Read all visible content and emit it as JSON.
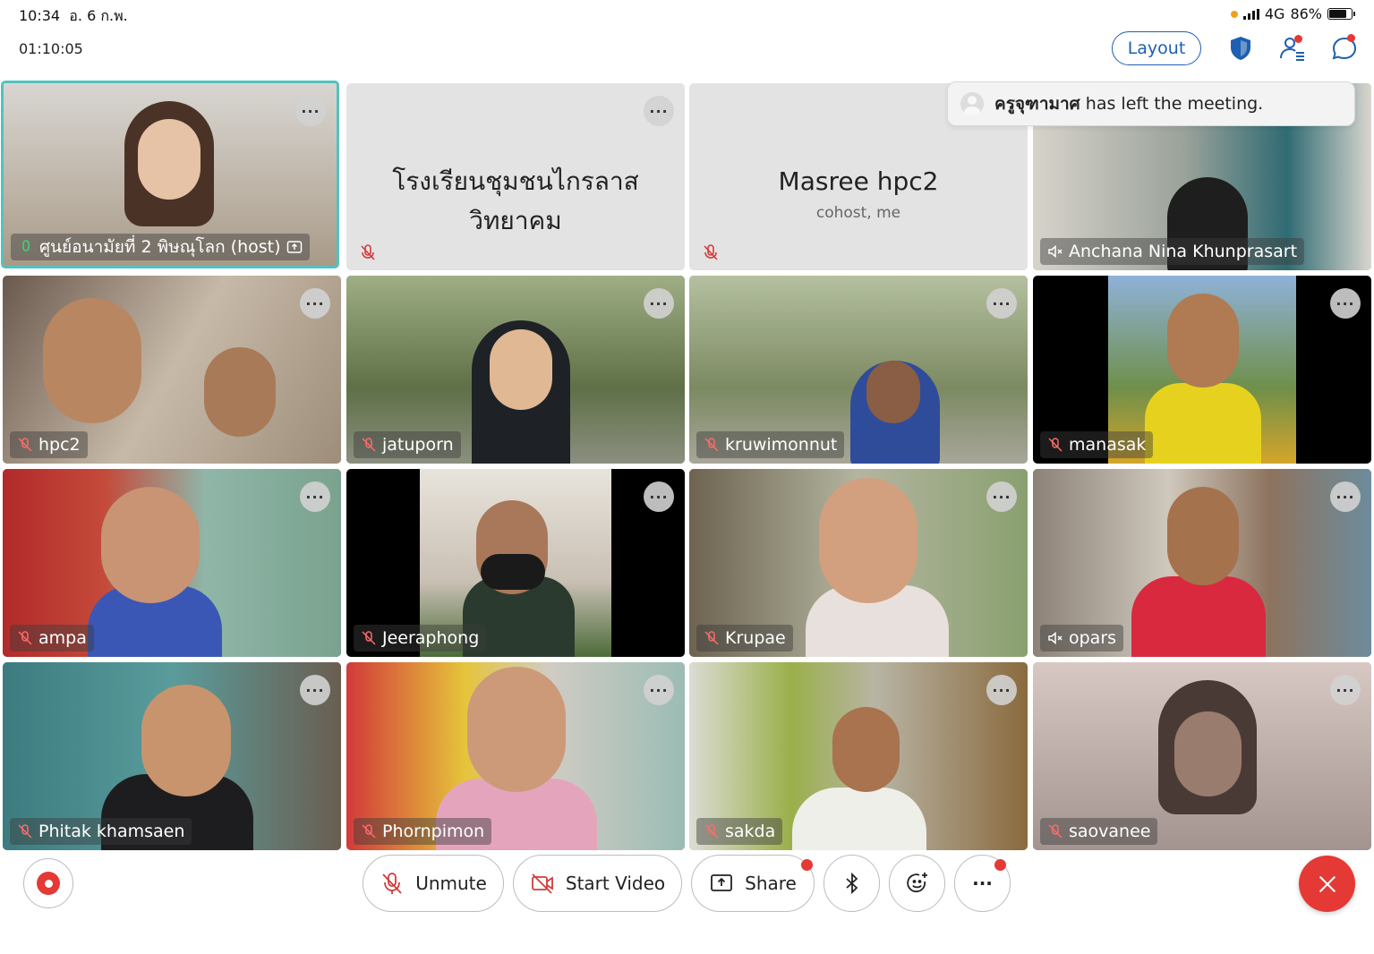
{
  "status_bar": {
    "time": "10:34",
    "date": "อ. 6 ก.พ.",
    "network": "4G",
    "battery": "86%",
    "battery_level": 0.86
  },
  "meeting": {
    "duration": "01:10:05",
    "layout_label": "Layout"
  },
  "notification": {
    "name": "ครูจุฑามาศ",
    "message": "has left the meeting."
  },
  "placeholders": {
    "school_name": "โรงเรียนชุมชนไกรลาสวิทยาคม",
    "self_name": "Masree hpc2",
    "self_role": "cohost, me"
  },
  "participants": [
    {
      "name": "ศูนย์อนามัยที่ 2 พิษณุโลก (host)",
      "status": "speaking",
      "bg": "#c9c2b8"
    },
    {
      "name": "Anchana Nina Khunprasart",
      "status": "speaker-muted",
      "bg": "#8a8f86"
    },
    {
      "name": "hpc2",
      "status": "muted",
      "bg": "#7c6d60"
    },
    {
      "name": "jatuporn",
      "status": "muted",
      "bg": "#6c7d55"
    },
    {
      "name": "kruwimonnut",
      "status": "muted",
      "bg": "#7b8864"
    },
    {
      "name": "manasak",
      "status": "muted",
      "bg": "#4d5a2f"
    },
    {
      "name": "ampa",
      "status": "muted",
      "bg": "#9c6d72"
    },
    {
      "name": "Jeeraphong",
      "status": "muted",
      "bg": "#2c2c2c"
    },
    {
      "name": "Krupae",
      "status": "muted",
      "bg": "#8b8f7a"
    },
    {
      "name": "opars",
      "status": "speaker-muted",
      "bg": "#8a7064"
    },
    {
      "name": "Phitak khamsaen",
      "status": "muted",
      "bg": "#3f6d73"
    },
    {
      "name": "Phornpimon",
      "status": "muted",
      "bg": "#b0869a"
    },
    {
      "name": "sakda",
      "status": "muted",
      "bg": "#8a8c6f"
    },
    {
      "name": "saovanee",
      "status": "muted",
      "bg": "#b8a8a5"
    }
  ],
  "toolbar": {
    "unmute": "Unmute",
    "start_video": "Start Video",
    "share": "Share",
    "more": "···"
  },
  "colors": {
    "accent": "#1d5fb1",
    "active_border": "#52c2c0",
    "end_call": "#e53935"
  }
}
